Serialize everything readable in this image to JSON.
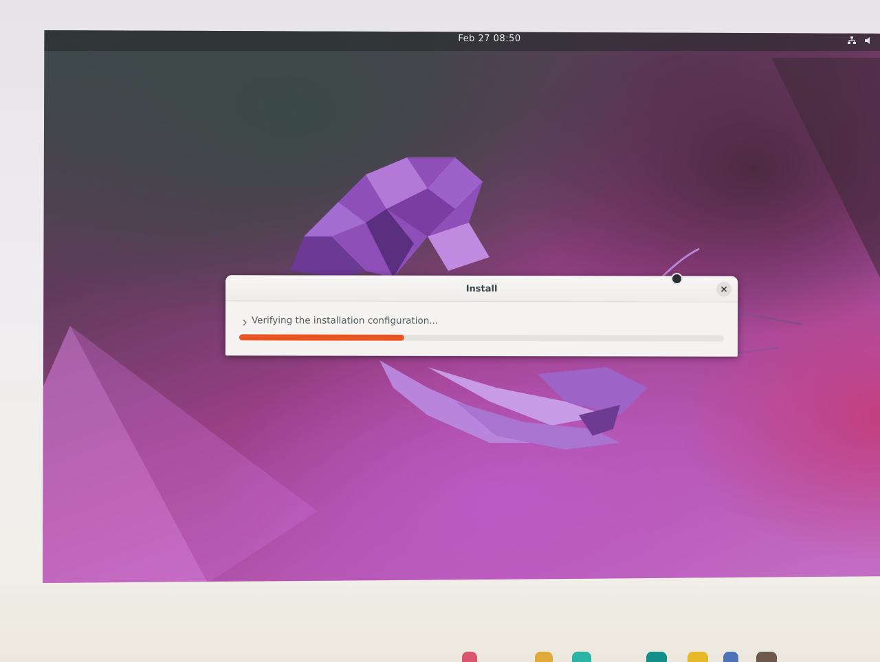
{
  "topbar": {
    "clock": "Feb 27  08:50",
    "icons": [
      "network-icon",
      "volume-icon"
    ]
  },
  "dialog": {
    "title": "Install",
    "status_text": "Verifying the installation configuration...",
    "progress_percent": 34,
    "close_icon": "close-icon",
    "expander_icon": "chevron-right-icon"
  },
  "colors": {
    "progress": "#e95420",
    "dialog_bg": "#f4f3f2",
    "topbar_text": "#e9ecec"
  }
}
